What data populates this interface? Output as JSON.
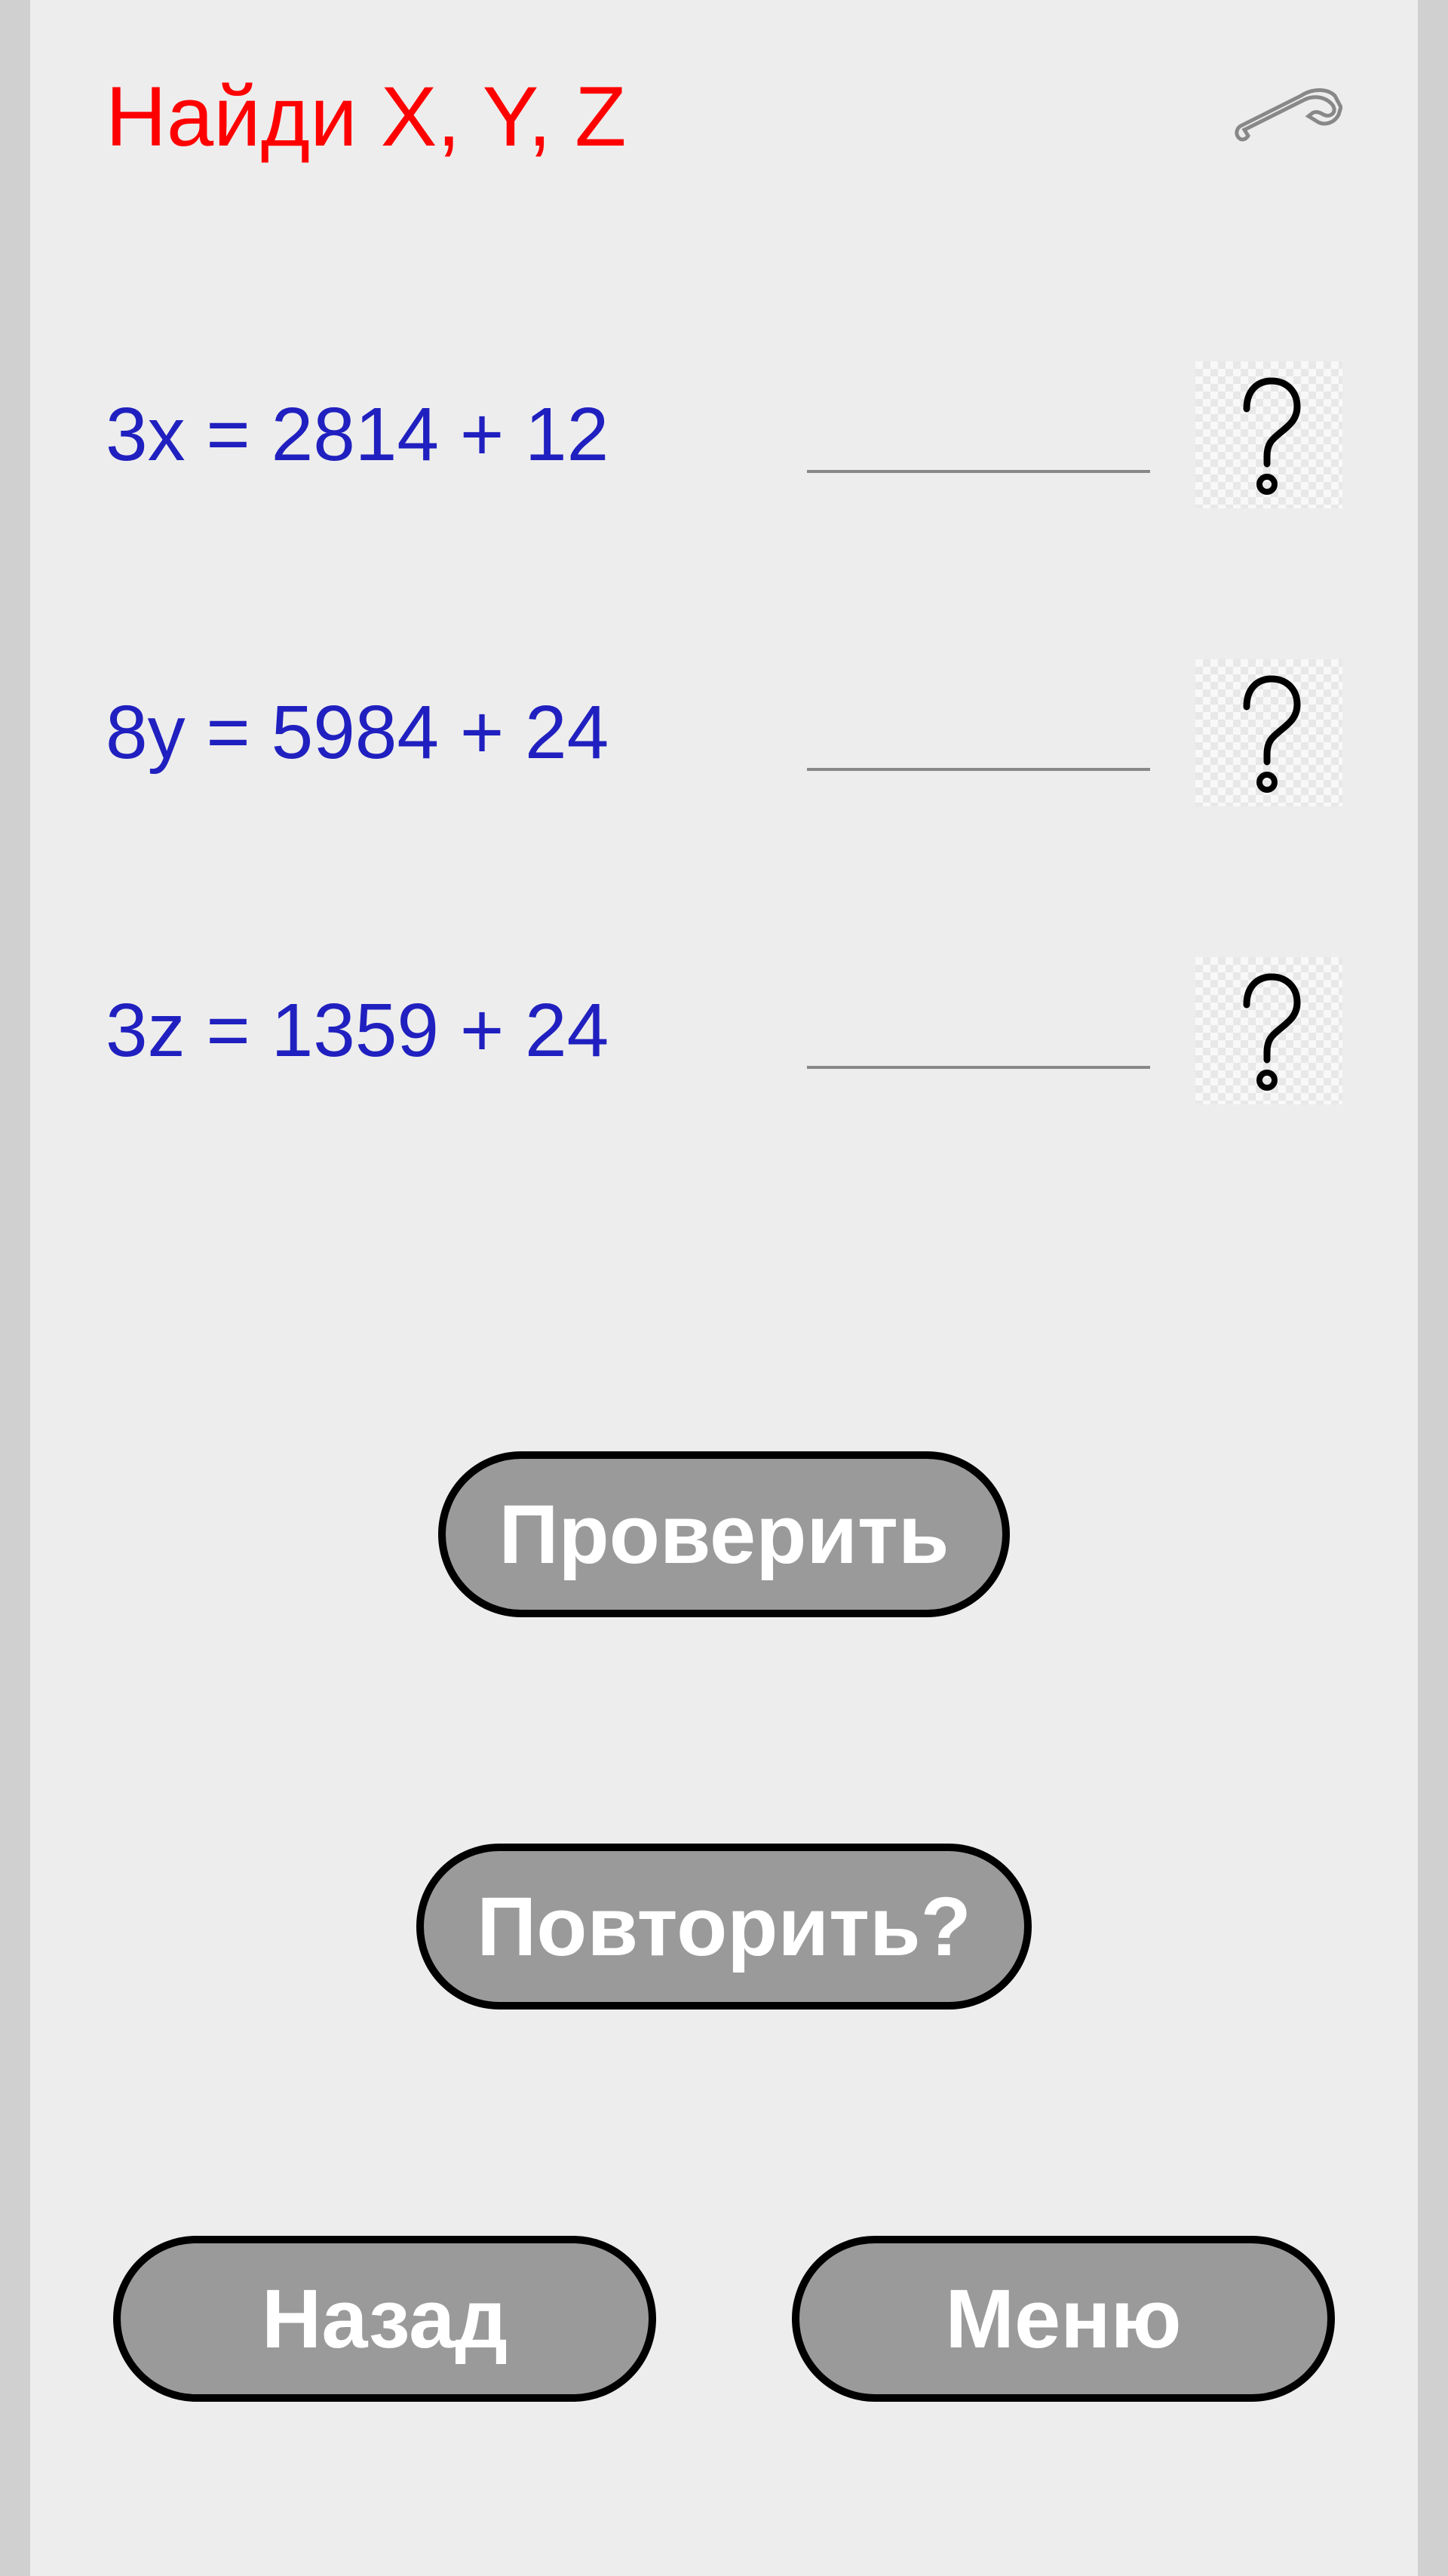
{
  "title": "Найди X, Y, Z",
  "equations": [
    {
      "text": "3x = 2814 + 12",
      "value": ""
    },
    {
      "text": "8y = 5984 + 24",
      "value": ""
    },
    {
      "text": "3z = 1359 + 24",
      "value": ""
    }
  ],
  "buttons": {
    "check": "Проверить",
    "repeat": "Повторить?",
    "back": "Назад",
    "menu": "Меню"
  },
  "icons": {
    "settings": "wrench-icon",
    "hint": "question-mark-icon"
  }
}
